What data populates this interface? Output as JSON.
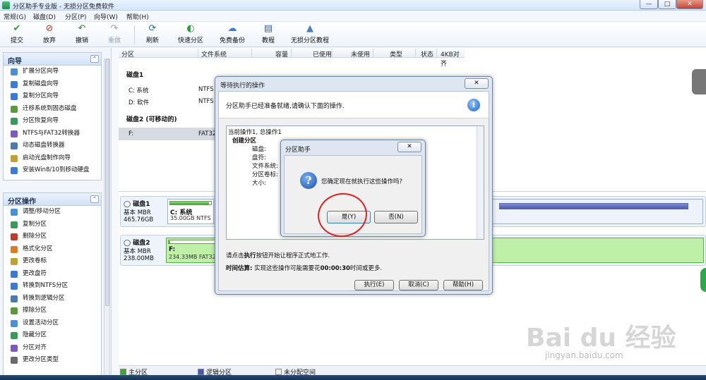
{
  "window": {
    "title": "分区助手专业版 - 无损分区免费软件",
    "min": "—",
    "max": "□",
    "close": "✕"
  },
  "menu": [
    "常规(G)",
    "磁盘(D)",
    "分区(P)",
    "向导(W)",
    "帮助(H)"
  ],
  "toolbar": [
    {
      "label": "提交",
      "icon": "✔",
      "color": "#2a9d3a",
      "disabled": false
    },
    {
      "label": "放弃",
      "icon": "⊘",
      "color": "#c0392b",
      "disabled": false
    },
    {
      "label": "撤销",
      "icon": "↶",
      "color": "#2f8a3f",
      "disabled": false
    },
    {
      "label": "重做",
      "icon": "↷",
      "color": "#9aa5b3",
      "disabled": true
    },
    {
      "label": "刷新",
      "icon": "⟳",
      "color": "#2a6ab8",
      "disabled": false
    },
    {
      "label": "快速分区",
      "icon": "◐",
      "color": "#2f9a46",
      "disabled": false
    },
    {
      "label": "免费备份",
      "icon": "☁",
      "color": "#3b7bd0",
      "disabled": false
    },
    {
      "label": "教程",
      "icon": "▤",
      "color": "#2f5ea8",
      "disabled": false
    },
    {
      "label": "无损分区教程",
      "icon": "▲",
      "color": "#4a7fbf",
      "disabled": false
    }
  ],
  "sidebar": {
    "wizard": {
      "title": "向导",
      "items": [
        {
          "label": "扩展分区向导",
          "color": "#4a90d9"
        },
        {
          "label": "复制磁盘向导",
          "color": "#3a7bd5"
        },
        {
          "label": "复制分区向导",
          "color": "#3a7bd5"
        },
        {
          "label": "迁移系统到固态磁盘",
          "color": "#5a9a3a"
        },
        {
          "label": "分区恢复向导",
          "color": "#3a9a5a"
        },
        {
          "label": "NTFS与FAT32转换器",
          "color": "#7a5ac0"
        },
        {
          "label": "动态磁盘转换器",
          "color": "#4a7ab0"
        },
        {
          "label": "启动光盘制作向导",
          "color": "#c0a030"
        },
        {
          "label": "安装Win8/10到移动硬盘",
          "color": "#3a7bd5"
        }
      ]
    },
    "ops": {
      "title": "分区操作",
      "items": [
        {
          "label": "调整/移动分区",
          "color": "#4a90d9"
        },
        {
          "label": "复制分区",
          "color": "#3a9a5a"
        },
        {
          "label": "删除分区",
          "color": "#c0392b"
        },
        {
          "label": "格式化分区",
          "color": "#e07a20"
        },
        {
          "label": "更改卷标",
          "color": "#c0a030"
        },
        {
          "label": "更改盘符",
          "color": "#3a7bd5"
        },
        {
          "label": "转换到NTFS分区",
          "color": "#3a7bd5"
        },
        {
          "label": "转换到逻辑分区",
          "color": "#4a7ab0"
        },
        {
          "label": "擦除分区",
          "color": "#5a9a3a"
        },
        {
          "label": "设置活动分区",
          "color": "#4a90d9"
        },
        {
          "label": "隐藏分区",
          "color": "#3a9a5a"
        },
        {
          "label": "分区对齐",
          "color": "#7a5ac0"
        },
        {
          "label": "更改分区类型",
          "color": "#6a6a6a"
        }
      ]
    }
  },
  "columns": [
    "分区",
    "文件系统",
    "容量",
    "已使用",
    "未使用",
    "类型",
    "状态",
    "4KB对齐"
  ],
  "disks": [
    {
      "name": "磁盘1",
      "partitions": [
        {
          "part": "C: 系统",
          "fs": "NTFS"
        },
        {
          "part": "D: 软件",
          "fs": "NTFS"
        }
      ]
    },
    {
      "name": "磁盘2 (可移动的)",
      "partitions": [
        {
          "part": "F:",
          "fs": "FAT32"
        }
      ]
    }
  ],
  "diskmap": [
    {
      "name": "磁盘1",
      "type": "基本 MBR",
      "size": "465.76GB",
      "part_title": "C: 系统",
      "part_size": "35.00GB NTFS",
      "used_fraction": 0.95
    },
    {
      "name": "磁盘2",
      "type": "基本 MBR",
      "size": "238.00MB",
      "part_title": "F:",
      "part_size": "234.33MB FAT32",
      "used_fraction": 0.03
    }
  ],
  "legend": [
    {
      "label": "主分区",
      "color": "#3fa535"
    },
    {
      "label": "逻辑分区",
      "color": "#4a58ae"
    },
    {
      "label": "未分配空间",
      "color": "#f4efe4"
    }
  ],
  "pending_dialog": {
    "title": "等待执行的操作",
    "close": "✕",
    "message": "分区助手已经准备就绪,请确认下面的操作.",
    "list": {
      "summary": "当前操作1, 总操作1",
      "op": "创建分区",
      "fields": [
        "磁盘:",
        "盘符:",
        "文件系统:",
        "分区卷标:",
        "大小:"
      ]
    },
    "note_prefix": "请点击",
    "note_bold": "执行",
    "note_suffix": "按钮开始让程序正式地工作.",
    "time_label": "时间估算:",
    "time_prefix": "实现这些操作可能需要花",
    "time_value": "00:00:30",
    "time_suffix": "时间或更多.",
    "buttons": {
      "execute": "执行(E)",
      "cancel": "取消(C)",
      "help": "帮助(H)"
    }
  },
  "confirm_dialog": {
    "title": "分区助手",
    "close": "✕",
    "message": "您确定现在就执行这些操作吗?",
    "yes": "是(Y)",
    "no": "否(N)"
  },
  "watermark": {
    "logo": "Bai du 经验",
    "url": "jingyan.baidu.com"
  }
}
